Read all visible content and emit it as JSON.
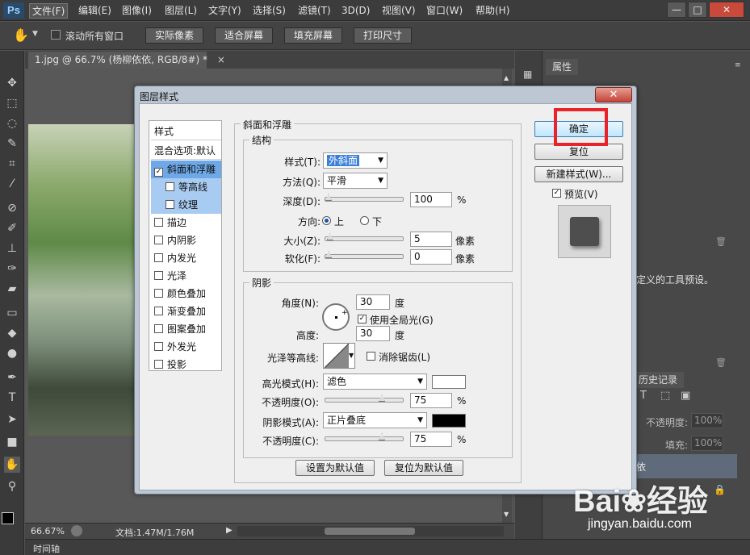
{
  "app": {
    "logo": "Ps"
  },
  "menu": [
    "文件(F)",
    "编辑(E)",
    "图像(I)",
    "图层(L)",
    "文字(Y)",
    "选择(S)",
    "滤镜(T)",
    "3D(D)",
    "视图(V)",
    "窗口(W)",
    "帮助(H)"
  ],
  "window_controls": {
    "minimize": "—",
    "maximize": "□",
    "close": "✕"
  },
  "options": {
    "scroll_all": "滚动所有窗口",
    "buttons": [
      "实际像素",
      "适合屏幕",
      "填充屏幕",
      "打印尺寸"
    ]
  },
  "document": {
    "tab": "1.jpg @ 66.7% (杨柳依依, RGB/8#) *",
    "tab_close": "×",
    "zoom": "66.67%",
    "doc_size": "文档:1.47M/1.76M"
  },
  "timeline": "时间轴",
  "right_panel": {
    "properties_tab": "属性",
    "tool_preset_text": "定义的工具预设。",
    "history_tab": "历史记录",
    "opacity_label": "不透明度:",
    "opacity_value": "100%",
    "fill_label": "填充:",
    "fill_value": "100%",
    "layer_text": "依"
  },
  "dialog": {
    "title": "图层样式",
    "close": "✕",
    "styles_header": "样式",
    "blend_default": "混合选项:默认",
    "items": [
      {
        "label": "斜面和浮雕",
        "checked": true
      },
      {
        "label": "等高线",
        "checked": false
      },
      {
        "label": "纹理",
        "checked": false
      },
      {
        "label": "描边",
        "checked": false
      },
      {
        "label": "内阴影",
        "checked": false
      },
      {
        "label": "内发光",
        "checked": false
      },
      {
        "label": "光泽",
        "checked": false
      },
      {
        "label": "颜色叠加",
        "checked": false
      },
      {
        "label": "渐变叠加",
        "checked": false
      },
      {
        "label": "图案叠加",
        "checked": false
      },
      {
        "label": "外发光",
        "checked": false
      },
      {
        "label": "投影",
        "checked": false
      }
    ],
    "bevel": {
      "section": "斜面和浮雕",
      "structure": "结构",
      "style_label": "样式(T):",
      "style_value": "外斜面",
      "method_label": "方法(Q):",
      "method_value": "平滑",
      "depth_label": "深度(D):",
      "depth_value": "100",
      "depth_pct": 0.0,
      "percent": "%",
      "direction_label": "方向:",
      "dir_up": "上",
      "dir_down": "下",
      "size_label": "大小(Z):",
      "size_value": "5",
      "size_pct": 0.02,
      "soften_label": "软化(F):",
      "soften_value": "0",
      "soften_pct": 0.0,
      "px_unit": "像素"
    },
    "shading": {
      "section": "阴影",
      "angle_label": "角度(N):",
      "angle_value": "30",
      "deg": "度",
      "global_light": "使用全局光(G)",
      "altitude_label": "高度:",
      "altitude_value": "30",
      "gloss_label": "光泽等高线:",
      "anti_alias": "消除锯齿(L)",
      "highlight_mode_label": "高光模式(H):",
      "highlight_mode": "滤色",
      "highlight_color": "#ffffff",
      "hl_opacity_label": "不透明度(O):",
      "hl_opacity": "75",
      "hl_opacity_pct": 0.75,
      "shadow_mode_label": "阴影模式(A):",
      "shadow_mode": "正片叠底",
      "shadow_color": "#000000",
      "sh_opacity_label": "不透明度(C):",
      "sh_opacity": "75",
      "sh_opacity_pct": 0.75,
      "percent": "%"
    },
    "make_default": "设置为默认值",
    "reset_default": "复位为默认值",
    "ok": "确定",
    "reset": "复位",
    "new_style": "新建样式(W)...",
    "preview": "预览(V)"
  },
  "watermark": {
    "main": "Bai❀经验",
    "url": "jingyan.baidu.com"
  }
}
